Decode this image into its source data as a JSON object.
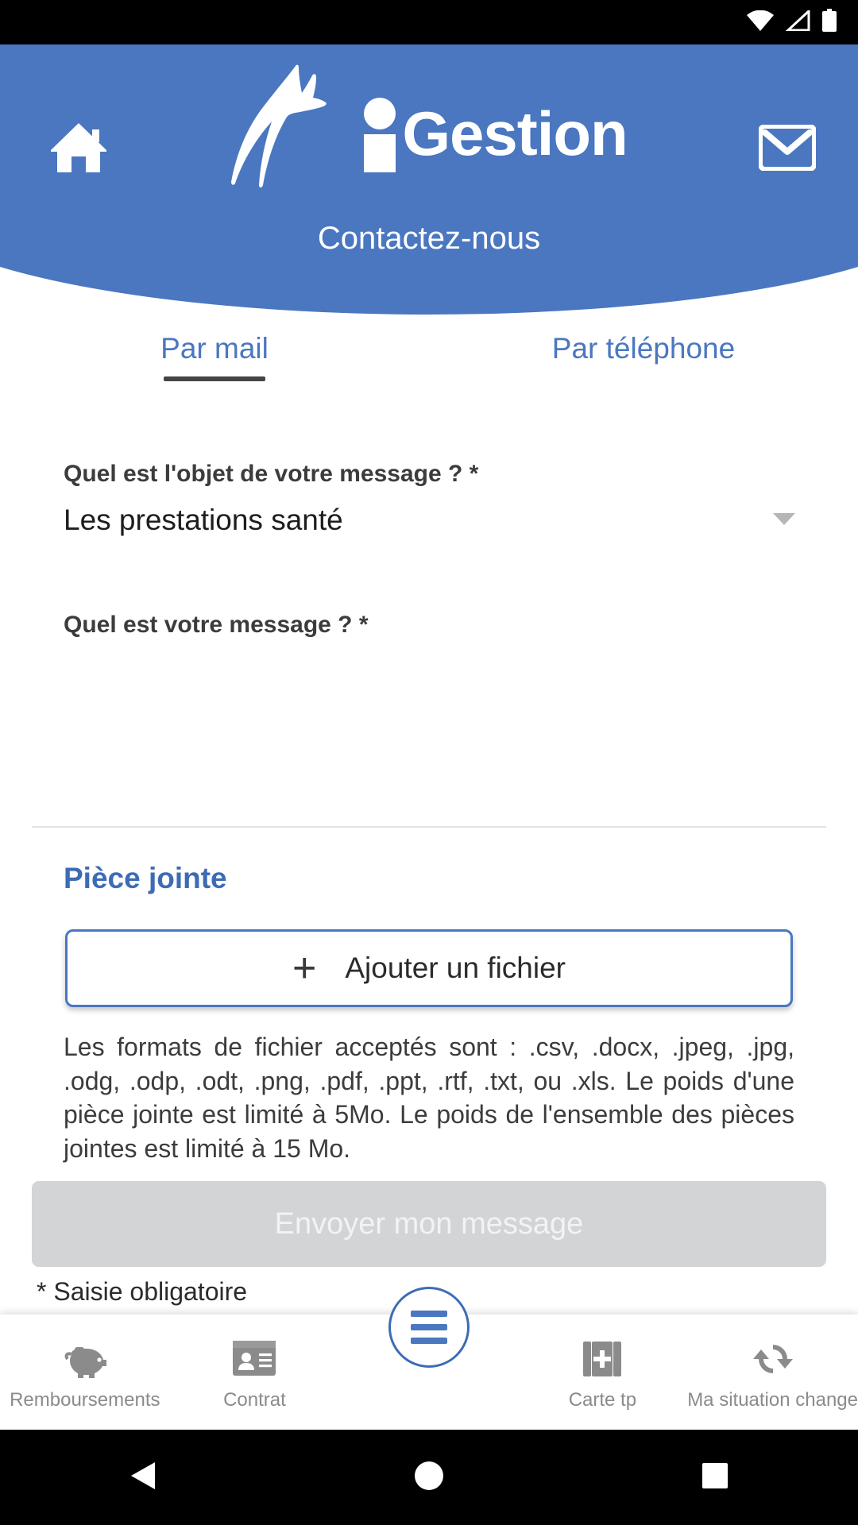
{
  "status_bar": {
    "icons": [
      "wifi-icon",
      "signal-icon",
      "battery-icon"
    ]
  },
  "header": {
    "home_icon": "home-icon",
    "mail_icon": "mail-icon",
    "logo_word": "Gestion",
    "logo_mark": "swoosh-bird-logo",
    "subtitle": "Contactez-nous",
    "brand_color": "#4a77c0"
  },
  "tabs": [
    {
      "label": "Par mail",
      "active": true
    },
    {
      "label": "Par téléphone",
      "active": false
    }
  ],
  "form": {
    "subject": {
      "label": "Quel est l'objet de votre message ? *",
      "value": "Les prestations santé",
      "chevron": "chevron-down-icon"
    },
    "message": {
      "label": "Quel est votre message ? *",
      "value": "",
      "placeholder": ""
    }
  },
  "attachment": {
    "title": "Pièce jointe",
    "add_button": {
      "icon": "plus-icon",
      "label": "Ajouter un fichier"
    },
    "formats_text": "Les formats de fichier acceptés sont : .csv, .docx, .jpeg, .jpg, .odg, .odp, .odt, .png, .pdf, .ppt, .rtf, .txt, ou .xls. Le poids d'une pièce jointe est limité à 5Mo. Le poids de l'ensemble des pièces jointes est limité à 15 Mo."
  },
  "submit": {
    "label": "Envoyer mon message",
    "disabled": true,
    "disabled_color": "#d2d4d6"
  },
  "required_note": "* Saisie obligatoire",
  "bottom_nav": {
    "items": [
      {
        "label": "Remboursements",
        "icon": "piggy-bank-icon"
      },
      {
        "label": "Contrat",
        "icon": "id-card-icon"
      },
      {
        "label": "Carte tp",
        "icon": "health-card-icon"
      },
      {
        "label": "Ma situation change",
        "icon": "refresh-icon"
      }
    ],
    "fab": {
      "icon": "menu-hamburger-icon"
    }
  },
  "android_nav": {
    "back": "back-triangle-icon",
    "home": "home-circle-icon",
    "recents": "recents-square-icon"
  }
}
